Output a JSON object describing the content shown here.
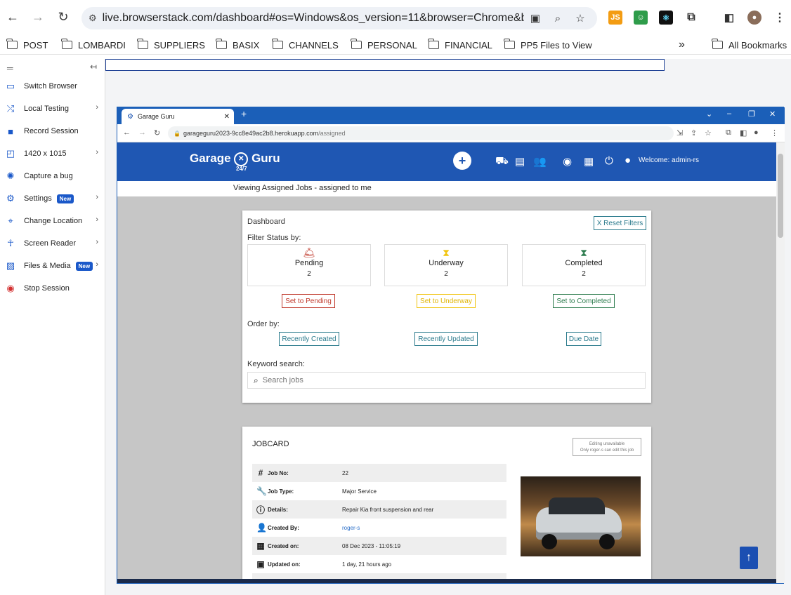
{
  "browser": {
    "url": "live.browserstack.com/dashboard#os=Windows&os_version=11&browser=Chrome&bro...",
    "ext_js": "JS"
  },
  "bookmarks": [
    "POST",
    "LOMBARDI",
    "SUPPLIERS",
    "BASIX",
    "CHANNELS",
    "PERSONAL",
    "FINANCIAL",
    "PP5 Files to View"
  ],
  "all_bookmarks": "All Bookmarks",
  "more_bookmarks": "»",
  "sidebar": {
    "items": [
      {
        "label": "Switch Browser",
        "icon": "laptop-icon",
        "chevron": false,
        "badge": ""
      },
      {
        "label": "Local Testing",
        "icon": "shuffle-icon",
        "chevron": true,
        "badge": ""
      },
      {
        "label": "Record Session",
        "icon": "video-camera-icon",
        "chevron": false,
        "badge": ""
      },
      {
        "label": "1420 x 1015",
        "icon": "resize-icon",
        "chevron": true,
        "badge": ""
      },
      {
        "label": "Capture a bug",
        "icon": "bug-icon",
        "chevron": false,
        "badge": ""
      },
      {
        "label": "Settings",
        "icon": "gear-icon",
        "chevron": true,
        "badge": "New"
      },
      {
        "label": "Change Location",
        "icon": "location-pin-icon",
        "chevron": true,
        "badge": ""
      },
      {
        "label": "Screen Reader",
        "icon": "accessibility-icon",
        "chevron": true,
        "badge": ""
      },
      {
        "label": "Files & Media",
        "icon": "image-icon",
        "chevron": true,
        "badge": "New"
      },
      {
        "label": "Stop Session",
        "icon": "stop-icon",
        "chevron": false,
        "badge": ""
      }
    ]
  },
  "remote": {
    "tab_title": "Garage Guru",
    "url_host": "garageguru2023-9cc8e49ac2b8.herokuapp.com",
    "url_path": "/assigned",
    "logo_left": "Garage",
    "logo_right": "Guru",
    "logo_sub": "24/7",
    "welcome": "Welcome: admin-rs",
    "viewing": "Viewing Assigned Jobs - assigned to me",
    "dashboard": {
      "title": "Dashboard",
      "reset": "X Reset Filters",
      "filter_label": "Filter Status by:",
      "statuses": [
        {
          "name": "Pending",
          "count": "2",
          "button": "Set to Pending",
          "color": "#c0392b"
        },
        {
          "name": "Underway",
          "count": "2",
          "button": "Set to Underway",
          "color": "#f1c40f"
        },
        {
          "name": "Completed",
          "count": "2",
          "button": "Set to Completed",
          "color": "#2e7d4f"
        }
      ],
      "order_label": "Order by:",
      "order_buttons": [
        "Recently Created",
        "Recently Updated",
        "Due Date"
      ],
      "keyword_label": "Keyword search:",
      "search_placeholder": "Search jobs"
    },
    "jobcard": {
      "title": "JOBCARD",
      "edit_line1": "Editing unavailable",
      "edit_line2": "Only roger-s can edit this job",
      "rows": [
        {
          "label": "Job No:",
          "value": "22",
          "icon": "hash-icon"
        },
        {
          "label": "Job Type:",
          "value": "Major Service",
          "icon": "wrench-icon"
        },
        {
          "label": "Details:",
          "value": "Repair Kia front suspension and rear",
          "icon": "info-icon"
        },
        {
          "label": "Created By:",
          "value": "roger-s",
          "icon": "user-icon"
        },
        {
          "label": "Created on:",
          "value": "08 Dec 2023 - 11:05:19",
          "icon": "calendar-icon"
        },
        {
          "label": "Updated on:",
          "value": "1 day, 21 hours ago",
          "icon": "calendar-plus-icon"
        }
      ]
    }
  }
}
